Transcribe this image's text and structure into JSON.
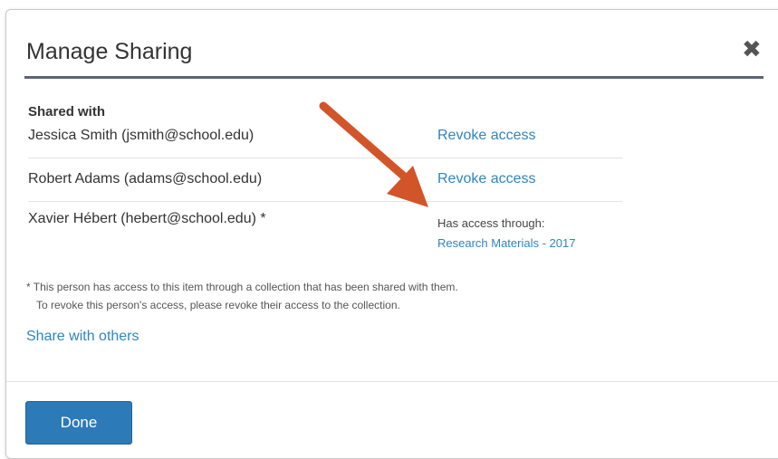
{
  "dialog": {
    "title": "Manage Sharing",
    "close_glyph": "✖"
  },
  "shared": {
    "section_label": "Shared with",
    "people": [
      {
        "name": "Jessica Smith (jsmith@school.edu)",
        "action": "Revoke access"
      },
      {
        "name": "Robert Adams (adams@school.edu)",
        "action": "Revoke access"
      },
      {
        "name": "Xavier Hébert (hebert@school.edu) *",
        "access_label": "Has access through:",
        "access_link": "Research Materials - 2017"
      }
    ]
  },
  "footnote": {
    "line1": "* This person has access to this item through a collection that has been shared with them.",
    "line2": "To revoke this person's access, please revoke their access to the collection."
  },
  "share_link": "Share with others",
  "footer": {
    "done_label": "Done"
  },
  "colors": {
    "link": "#2e86c1",
    "primary_button": "#2d7ab8",
    "annotation_arrow": "#d2552a",
    "header_rule": "#5c6575"
  },
  "annotation": {
    "icon": "callout-arrow-icon"
  }
}
